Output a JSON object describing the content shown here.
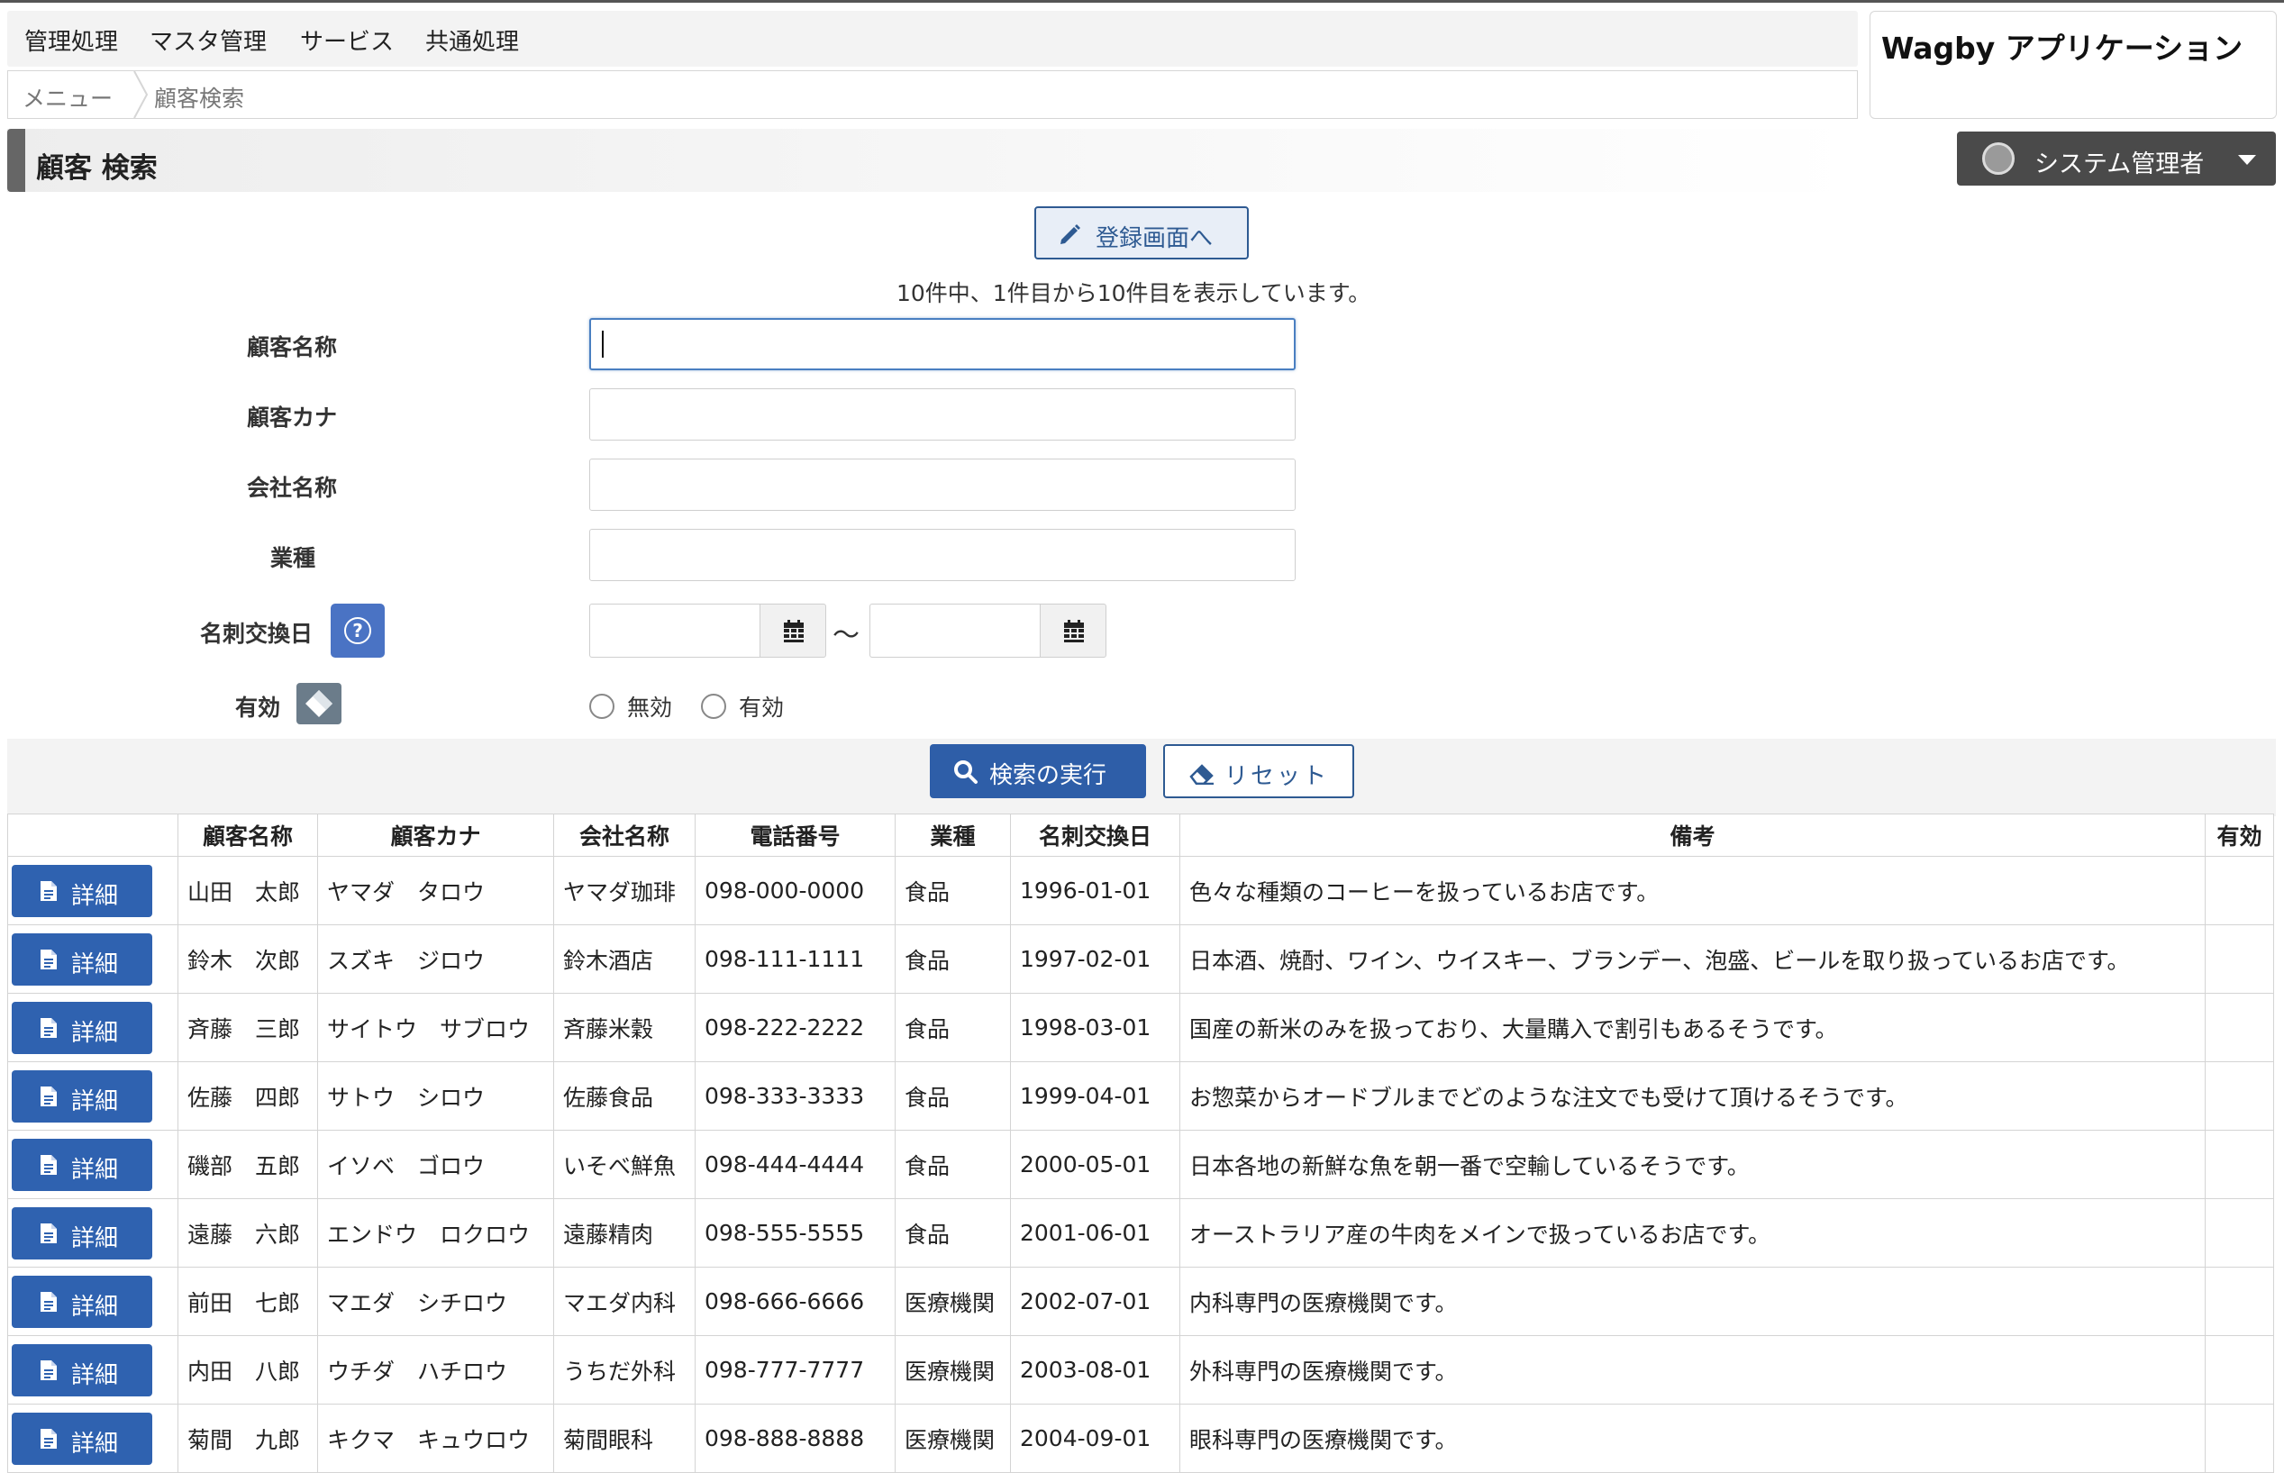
{
  "app": {
    "title": "Wagby アプリケーション"
  },
  "menu": {
    "items": [
      "管理処理",
      "マスタ管理",
      "サービス",
      "共通処理"
    ]
  },
  "breadcrumb": {
    "items": [
      "メニュー",
      "顧客検索"
    ]
  },
  "page": {
    "title": "顧客 検索"
  },
  "user": {
    "name": "システム管理者"
  },
  "actions": {
    "register_label": "登録画面へ",
    "search_label": "検索の実行",
    "reset_label": "リセット"
  },
  "result_count": "10件中、1件目から10件目を表示しています。",
  "form": {
    "customer_name_label": "顧客名称",
    "customer_kana_label": "顧客カナ",
    "company_name_label": "会社名称",
    "industry_label": "業種",
    "card_exchange_date_label": "名刺交換日",
    "date_range_separator": "〜",
    "valid_label": "有効",
    "valid_options": [
      "無効",
      "有効"
    ]
  },
  "table": {
    "headers": [
      "",
      "顧客名称",
      "顧客カナ",
      "会社名称",
      "電話番号",
      "業種",
      "名刺交換日",
      "備考",
      "有効"
    ],
    "detail_label": "詳細",
    "rows": [
      {
        "name": "山田　太郎",
        "kana": "ヤマダ　タロウ",
        "company": "ヤマダ珈琲",
        "phone": "098-000-0000",
        "industry": "食品",
        "date": "1996-01-01",
        "note": "色々な種類のコーヒーを扱っているお店です。",
        "valid": ""
      },
      {
        "name": "鈴木　次郎",
        "kana": "スズキ　ジロウ",
        "company": "鈴木酒店",
        "phone": "098-111-1111",
        "industry": "食品",
        "date": "1997-02-01",
        "note": "日本酒、焼酎、ワイン、ウイスキー、ブランデー、泡盛、ビールを取り扱っているお店です。",
        "valid": ""
      },
      {
        "name": "斉藤　三郎",
        "kana": "サイトウ　サブロウ",
        "company": "斉藤米穀",
        "phone": "098-222-2222",
        "industry": "食品",
        "date": "1998-03-01",
        "note": "国産の新米のみを扱っており、大量購入で割引もあるそうです。",
        "valid": ""
      },
      {
        "name": "佐藤　四郎",
        "kana": "サトウ　シロウ",
        "company": "佐藤食品",
        "phone": "098-333-3333",
        "industry": "食品",
        "date": "1999-04-01",
        "note": "お惣菜からオードブルまでどのような注文でも受けて頂けるそうです。",
        "valid": ""
      },
      {
        "name": "磯部　五郎",
        "kana": "イソベ　ゴロウ",
        "company": "いそべ鮮魚",
        "phone": "098-444-4444",
        "industry": "食品",
        "date": "2000-05-01",
        "note": "日本各地の新鮮な魚を朝一番で空輸しているそうです。",
        "valid": ""
      },
      {
        "name": "遠藤　六郎",
        "kana": "エンドウ　ロクロウ",
        "company": "遠藤精肉",
        "phone": "098-555-5555",
        "industry": "食品",
        "date": "2001-06-01",
        "note": "オーストラリア産の牛肉をメインで扱っているお店です。",
        "valid": ""
      },
      {
        "name": "前田　七郎",
        "kana": "マエダ　シチロウ",
        "company": "マエダ内科",
        "phone": "098-666-6666",
        "industry": "医療機関",
        "date": "2002-07-01",
        "note": "内科専門の医療機関です。",
        "valid": ""
      },
      {
        "name": "内田　八郎",
        "kana": "ウチダ　ハチロウ",
        "company": "うちだ外科",
        "phone": "098-777-7777",
        "industry": "医療機関",
        "date": "2003-08-01",
        "note": "外科専門の医療機関です。",
        "valid": ""
      },
      {
        "name": "菊間　九郎",
        "kana": "キクマ　キュウロウ",
        "company": "菊間眼科",
        "phone": "098-888-8888",
        "industry": "医療機関",
        "date": "2004-09-01",
        "note": "眼科専門の医療機関です。",
        "valid": ""
      }
    ]
  }
}
